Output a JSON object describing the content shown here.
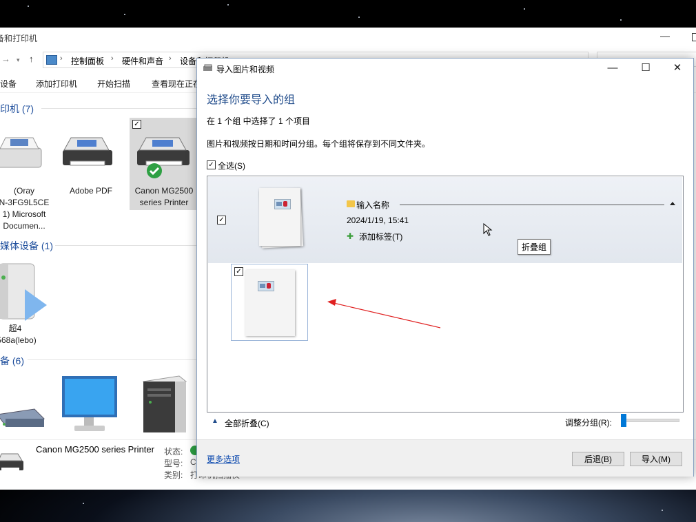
{
  "background_window": {
    "title": "备和打印机",
    "address": {
      "crumbs": [
        "控制面板",
        "硬件和声音",
        "设备和打印机"
      ]
    },
    "toolbar": [
      "设备",
      "添加打印机",
      "开始扫描",
      "查看现在正在打印什么"
    ],
    "groups": {
      "printers": "印机 (7)",
      "multimedia": "媒体设备 (1)",
      "devices": "备 (6)"
    },
    "devices": {
      "oray": [
        "(Oray",
        "N-3FG9L5CE",
        "1) Microsoft",
        "Documen..."
      ],
      "adobe": "Adobe PDF",
      "canon": [
        "Canon MG2500",
        "series Printer"
      ],
      "chao4": [
        "超4",
        "-568a(lebo)"
      ]
    },
    "status": {
      "name": "Canon MG2500 series Printer",
      "state_label": "状态:",
      "model_label": "型号:",
      "category_label": "类别:",
      "model_value": "C",
      "category_value": "打印机扫描仪"
    }
  },
  "dialog": {
    "title": "导入图片和视频",
    "heading": "选择你要导入的组",
    "summary": "在 1 个组 中选择了 1 个项目",
    "description": "图片和视频按日期和时间分组。每个组将保存到不同文件夹。",
    "select_all": "全选(S)",
    "group": {
      "name_placeholder": "输入名称",
      "datetime": "2024/1/19, 15:41",
      "add_tag": "添加标签(T)",
      "tooltip": "折叠组"
    },
    "collapse_all": "全部折叠(C)",
    "adjust_grouping": "调整分组(R):",
    "grouping_level": 0.05,
    "more_options": "更多选项",
    "back_button": "后退(B)",
    "import_button": "导入(M)"
  },
  "colors": {
    "accent": "#0078d7",
    "heading": "#1e4a8a",
    "annotation_arrow": "#e02020"
  }
}
